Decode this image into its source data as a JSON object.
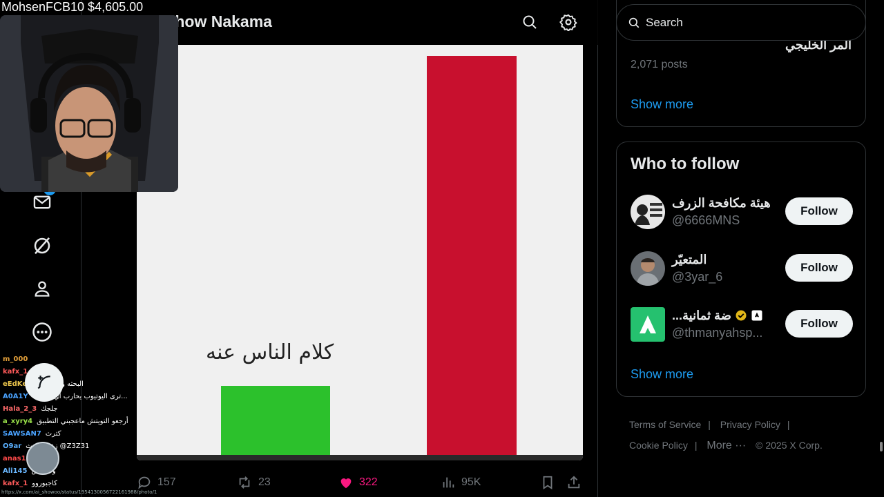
{
  "stream": {
    "label": "MohsenFCB10 $4,605.00"
  },
  "header": {
    "title": "Show Nakama"
  },
  "nav": {
    "messages_badge": "1"
  },
  "media": {
    "caption": "كلام الناس عنه",
    "colors": {
      "green": "#2cc12c",
      "red": "#c8102e",
      "background": "#f0f0f0"
    }
  },
  "actions": {
    "replies": "157",
    "reposts": "23",
    "likes": "322",
    "views": "95K",
    "like_color": "#f91880"
  },
  "chat": [
    {
      "user": "m_000",
      "msg": "",
      "color": "#e3a03a"
    },
    {
      "user": "kafx_1",
      "msg": "",
      "color": "#ff5a5a"
    },
    {
      "user": "eEdKes3o3",
      "msg": "البحثه ولا ما",
      "color": "#e9c34b"
    },
    {
      "user": "A0A1Y",
      "msg": "ترى اليوتيوب يحارب اي شي ك...",
      "color": "#4aa3ff"
    },
    {
      "user": "Hala_2_3",
      "msg": "جلجك",
      "color": "#ff6a6a"
    },
    {
      "user": "a_xyry4",
      "msg": "أرجعو التويتش ماعجبني التطبيق",
      "color": "#9be34a"
    },
    {
      "user": "SAWSAN7",
      "msg": "كترث",
      "color": "#4aa3ff"
    },
    {
      "user": "O9ar",
      "msg": "زعزع حدث @Z3Z31",
      "color": "#5ab0ff"
    },
    {
      "user": "anas1",
      "msg": "خاوي",
      "color": "#ff4a4a"
    },
    {
      "user": "Ali145",
      "msg": "ولا بيبس",
      "color": "#6ab7ff"
    },
    {
      "user": "kafx_1",
      "msg": "كاجبوروو",
      "color": "#ff5a5a"
    }
  ],
  "status_url": "https://x.com/ai_showoo/status/1954130056722161988/photo/1",
  "sidebar": {
    "search_placeholder": "Search",
    "trend": {
      "title": "المر الخليجي",
      "count": "2,071 posts",
      "show_more": "Show more"
    },
    "who_to_follow": {
      "title": "Who to follow",
      "accounts": [
        {
          "name": "هيئة مكافحة الزرف",
          "handle": "@6666MNS",
          "button": "Follow"
        },
        {
          "name": "المتعيّر",
          "handle": "@3yar_6",
          "button": "Follow"
        },
        {
          "name": "...ضة ثمانية",
          "handle": "@thmanyahsp...",
          "button": "Follow"
        }
      ],
      "show_more": "Show more"
    },
    "footer": {
      "terms": "Terms of Service",
      "privacy": "Privacy Policy",
      "cookie": "Cookie Policy",
      "more": "More ···",
      "copyright": "© 2025 X Corp."
    }
  }
}
